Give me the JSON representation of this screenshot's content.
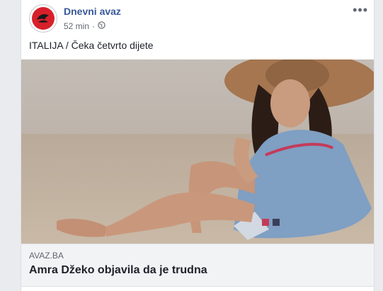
{
  "post": {
    "page_name": "Dnevni avaz",
    "time": "52 min",
    "separator": "·",
    "privacy_icon": "globe-icon",
    "more_icon": "more-horizontal-icon",
    "text": "ITALIJA / Čeka četvrto dijete"
  },
  "link": {
    "domain": "AVAZ.BA",
    "title": "Amra Džeko objavila da je trudna"
  },
  "colors": {
    "brand_red": "#d8202b",
    "name_blue": "#385898"
  }
}
